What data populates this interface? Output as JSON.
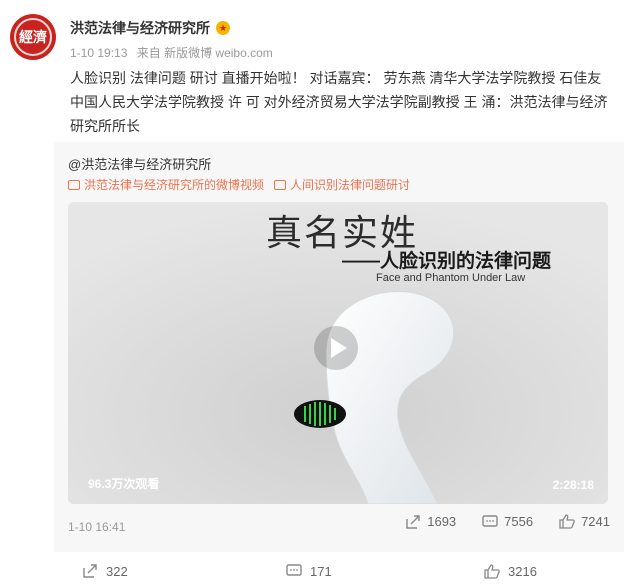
{
  "post": {
    "author": "洪范法律与经济研究所",
    "avatar_text": "經濟",
    "badge_icon": "vip-badge-icon",
    "time": "1-10 19:13",
    "source": "来自 新版微博 weibo.com",
    "text": "人脸识别 法律问题 研讨 直播开始啦！ 对话嘉宾： 劳东燕 清华大学法学院教授 石佳友 中国人民大学法学院教授 许 可 对外经济贸易大学法学院副教授 王 涌：洪范法律与经济研究所所长"
  },
  "repost": {
    "author": "@洪范法律与经济研究所",
    "links": [
      {
        "icon": "video-link-icon",
        "label": "洪范法律与经济研究所的微博视频"
      },
      {
        "icon": "topic-link-icon",
        "label": "人间识别法律问题研讨"
      }
    ],
    "video": {
      "title": "真名实姓",
      "subtitle": "——人脸识别的法律问题",
      "subtitle_en": "Face and Phantom Under Law",
      "view_count": "96.3万次观看",
      "duration": "2:28:18"
    },
    "time": "1-10 16:41",
    "stats": {
      "reposts": "1693",
      "comments": "7556",
      "likes": "7241"
    }
  },
  "actions": {
    "reposts": "322",
    "comments": "171",
    "likes": "3216"
  },
  "colors": {
    "link": "#eb7350",
    "avatar": "#c8231f",
    "panel": "#f7f7f7"
  }
}
